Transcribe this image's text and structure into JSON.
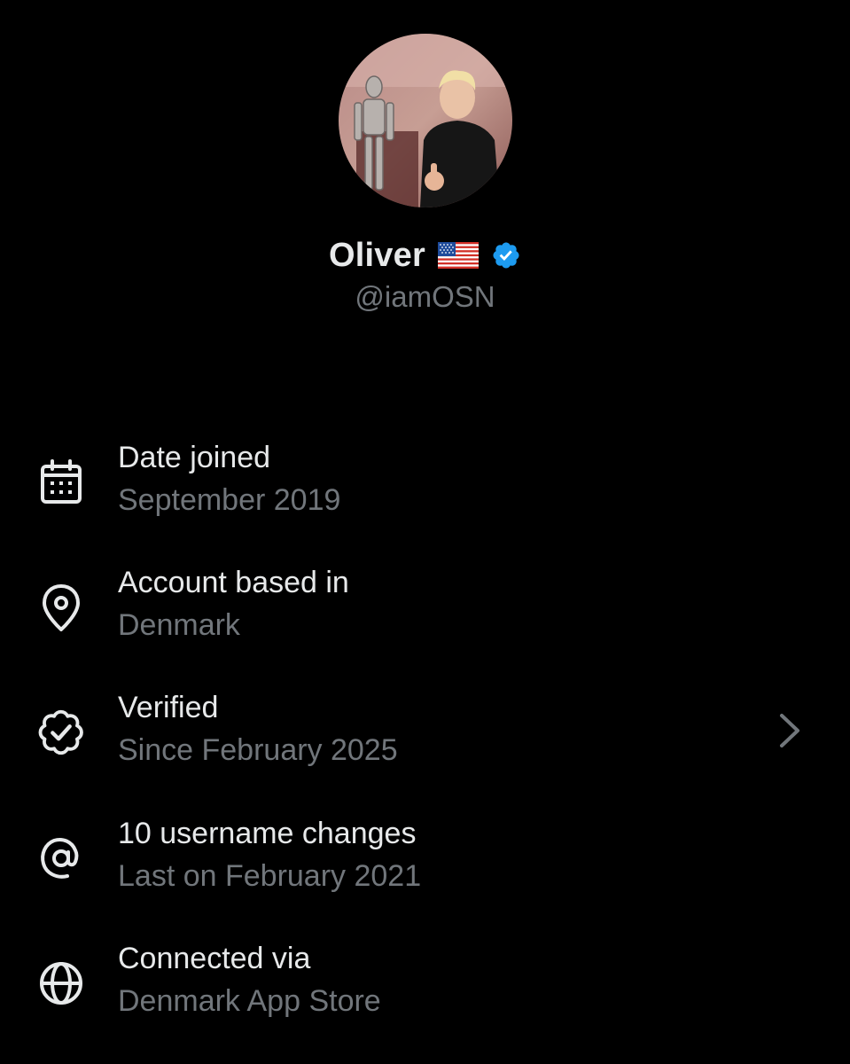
{
  "profile": {
    "display_name": "Oliver",
    "handle": "@iamOSN",
    "flag_icon": "us-flag-icon",
    "badge_icon": "verified-badge-icon",
    "badge_color": "#1d9bf0"
  },
  "details": [
    {
      "icon": "calendar-icon",
      "title": "Date joined",
      "subtitle": "September 2019"
    },
    {
      "icon": "location-pin-icon",
      "title": "Account based in",
      "subtitle": "Denmark"
    },
    {
      "icon": "verified-check-icon",
      "title": "Verified",
      "subtitle": "Since February 2025",
      "chevron": "chevron-right-icon"
    },
    {
      "icon": "at-sign-icon",
      "title": "10 username changes",
      "subtitle": "Last on February 2021"
    },
    {
      "icon": "globe-icon",
      "title": "Connected via",
      "subtitle": "Denmark App Store"
    }
  ],
  "colors": {
    "background": "#000000",
    "primary_text": "#e7e9ea",
    "secondary_text": "#71767b"
  }
}
